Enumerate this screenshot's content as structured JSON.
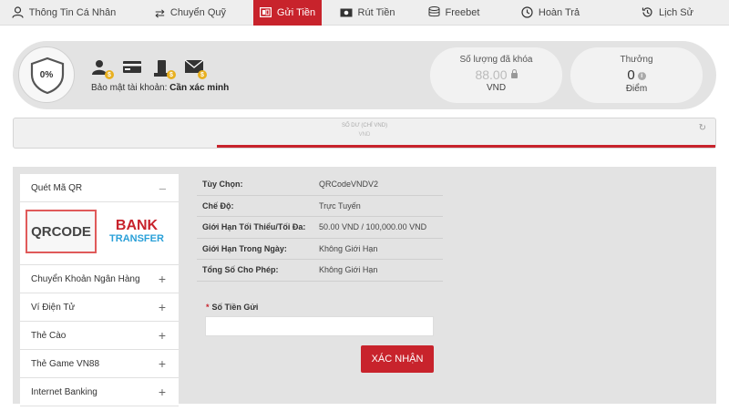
{
  "nav": {
    "items": [
      {
        "label": "Thông Tin Cá Nhân",
        "icon": "user-icon"
      },
      {
        "label": "Chuyển Quỹ",
        "icon": "transfer-icon"
      },
      {
        "label": "Gửi Tiền",
        "icon": "deposit-icon"
      },
      {
        "label": "Rút Tiền",
        "icon": "withdraw-icon"
      },
      {
        "label": "Freebet",
        "icon": "coins-icon"
      },
      {
        "label": "Hoàn Trả",
        "icon": "rebate-icon"
      },
      {
        "label": "Lịch Sử",
        "icon": "history-icon"
      }
    ],
    "active_index": 2
  },
  "security": {
    "percent": "0%",
    "label": "Bảo mật tài khoản:",
    "status": "Cần xác minh",
    "icons": [
      "user-verify-icon",
      "card-verify-icon",
      "phone-verify-icon",
      "email-verify-icon"
    ],
    "coin_symbol": "$"
  },
  "locked_balance": {
    "title": "Số lượng đã khóa",
    "value": "88.00",
    "unit": "VND"
  },
  "bonus": {
    "title": "Thưởng",
    "value": "0",
    "unit": "Điểm"
  },
  "balance_bar": {
    "label": "SỐ DƯ (CHỈ VND)",
    "sub": "VND",
    "refresh_icon": "refresh-icon"
  },
  "sidebar": {
    "head": {
      "label": "Quét Mã QR",
      "toggle": "–"
    },
    "logos": {
      "qr": "QRCODE",
      "bank_top": "BANK",
      "bank_bottom": "TRANSFER"
    },
    "items": [
      {
        "label": "Chuyển Khoản Ngân Hàng",
        "toggle": "+"
      },
      {
        "label": "Ví Điện Tử",
        "toggle": "+"
      },
      {
        "label": "Thẻ Cào",
        "toggle": "+"
      },
      {
        "label": "Thẻ Game VN88",
        "toggle": "+"
      },
      {
        "label": "Internet Banking",
        "toggle": "+"
      }
    ]
  },
  "details": [
    {
      "key": "Tùy Chọn:",
      "value": "QRCodeVNDV2"
    },
    {
      "key": "Chế Độ:",
      "value": "Trực Tuyến"
    },
    {
      "key": "Giới Hạn Tối Thiểu/Tối Đa:",
      "value": "50.00 VND / 100,000.00 VND"
    },
    {
      "key": "Giới Hạn Trong Ngày:",
      "value": "Không Giới Hạn"
    },
    {
      "key": "Tổng Số Cho Phép:",
      "value": "Không Giới Hạn"
    }
  ],
  "amount": {
    "required_mark": "*",
    "label": "Số Tiền Gửi",
    "value": "",
    "placeholder": ""
  },
  "submit_label": "XÁC NHẬN",
  "colors": {
    "accent": "#c8232c",
    "panel": "#e3e3e3",
    "bank_blue": "#2aa0d8",
    "coin": "#e8b020"
  }
}
